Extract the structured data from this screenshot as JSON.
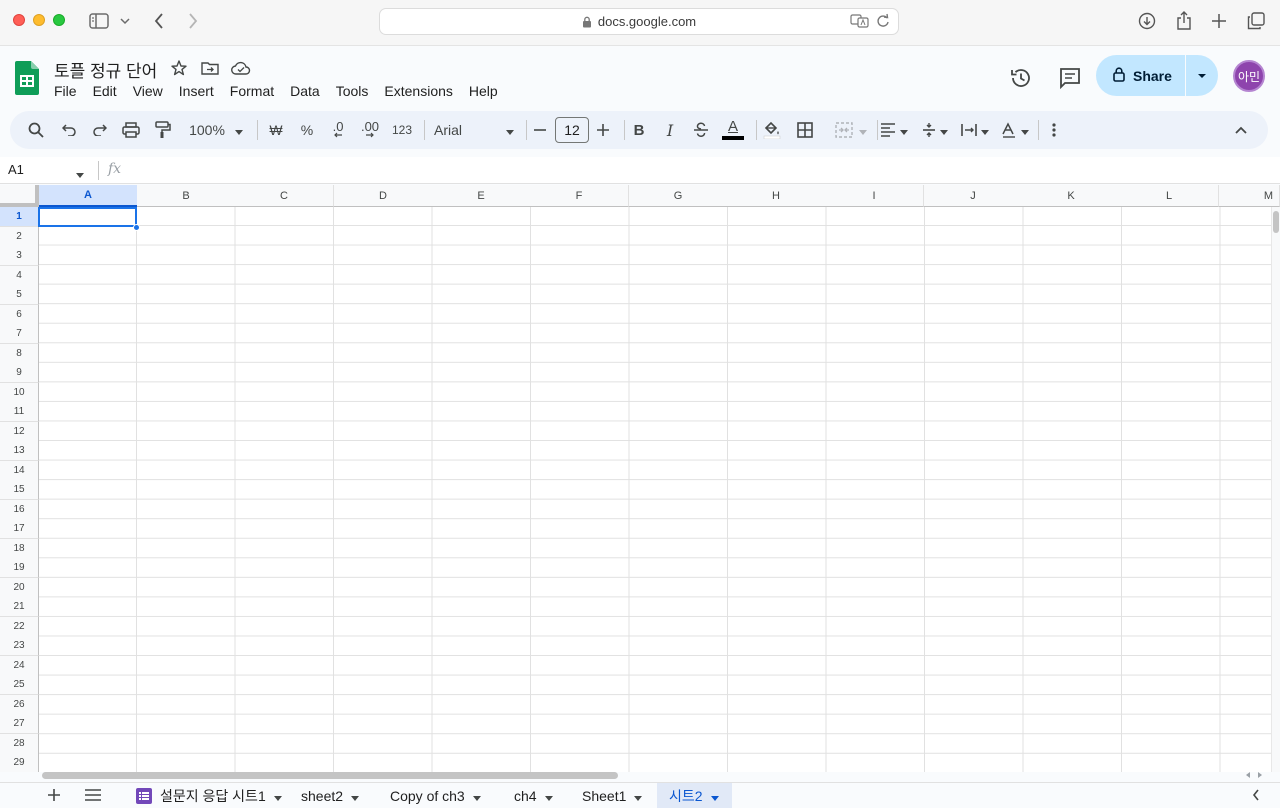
{
  "browser": {
    "url": "docs.google.com"
  },
  "doc": {
    "title": "토플 정규 단어",
    "menu": [
      "File",
      "Edit",
      "View",
      "Insert",
      "Format",
      "Data",
      "Tools",
      "Extensions",
      "Help"
    ],
    "share_label": "Share",
    "avatar_initials": "아민"
  },
  "toolbar": {
    "zoom": "100%",
    "currency": "₩",
    "percent": "%",
    "decrease_decimal": ".0",
    "increase_decimal": ".00",
    "number_format": "123",
    "font": "Arial",
    "font_size": "12",
    "bold": "B",
    "italic": "I",
    "text_color_glyph": "A"
  },
  "formula_bar": {
    "cell_ref": "A1",
    "fx": "fx",
    "value": ""
  },
  "grid": {
    "columns": [
      "A",
      "B",
      "C",
      "D",
      "E",
      "F",
      "G",
      "H",
      "I",
      "J",
      "K",
      "L",
      "M"
    ],
    "rows": [
      "1",
      "2",
      "3",
      "4",
      "5",
      "6",
      "7",
      "8",
      "9",
      "10",
      "11",
      "12",
      "13",
      "14",
      "15",
      "16",
      "17",
      "18",
      "19",
      "20",
      "21",
      "22",
      "23",
      "24",
      "25",
      "26",
      "27",
      "28",
      "29"
    ],
    "selected_cell": "A1"
  },
  "sheets": {
    "tabs": [
      "설문지 응답 시트1",
      "sheet2",
      "Copy of ch3",
      "ch4",
      "Sheet1",
      "시트2"
    ],
    "active": "시트2"
  },
  "colors": {
    "accent": "#0b57d0",
    "share_bg": "#c2e7ff",
    "sheets_green": "#0f9d58",
    "avatar": "#8e44ad"
  }
}
